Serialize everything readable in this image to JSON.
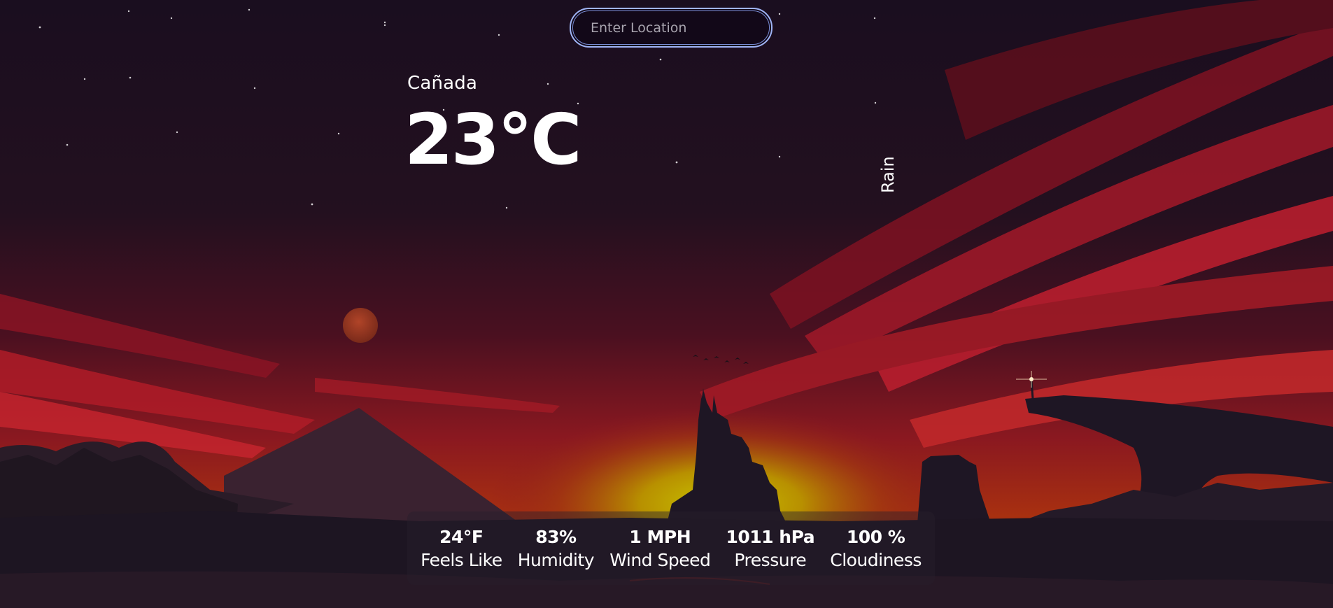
{
  "search": {
    "placeholder": "Enter Location",
    "value": ""
  },
  "weather": {
    "location": "Cañada",
    "temperature": "23°C",
    "condition": "Rain"
  },
  "stats": [
    {
      "value": "24°F",
      "label": "Feels Like"
    },
    {
      "value": "83%",
      "label": "Humidity"
    },
    {
      "value": "1 MPH",
      "label": "Wind Speed"
    },
    {
      "value": "1011 hPa",
      "label": "Pressure"
    },
    {
      "value": "100 %",
      "label": "Cloudiness"
    }
  ],
  "colors": {
    "sky_top": "#1a0f1e",
    "sky_red": "#8c1424",
    "sun_glow": "#a8a800",
    "silhouette": "#1e1624",
    "search_border": "#9fb4f5"
  }
}
